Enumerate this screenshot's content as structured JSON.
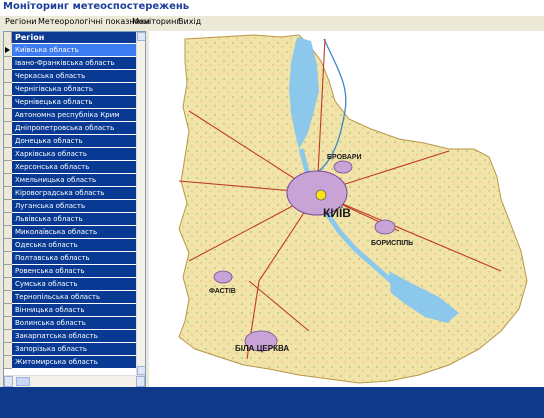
{
  "window": {
    "title": "Моніторинг метеоспостережень"
  },
  "menu": [
    "Регіони",
    "Метеорологічні показники",
    "Моніторинг",
    "Вихід"
  ],
  "regions": {
    "header": "Регіон",
    "items": [
      "Київська область",
      "Івано-Франківська область",
      "Черкаська область",
      "Чернігівська область",
      "Чернівецька область",
      "Автономна республіка Крим",
      "Дніпропетровська область",
      "Донецька область",
      "Харківська область",
      "Херсонська область",
      "Хмельницька область",
      "Кіровоградська область",
      "Луганська область",
      "Львівська область",
      "Миколаївська область",
      "Одеська область",
      "Полтавська область",
      "Ровенська область",
      "Сумська область",
      "Тернопільська область",
      "Вінницька область",
      "Волинська область",
      "Закарпатська область",
      "Запорізька область",
      "Житомирська область"
    ],
    "selected_index": 0
  },
  "map": {
    "cities": {
      "kyiv": "КИЇВ",
      "bila_tserkva": "БІЛА ЦЕРКВА",
      "boryspil": "БОРИСПІЛЬ",
      "brovary": "БРОВАРИ",
      "fastiv": "ФАСТІВ"
    },
    "colors": {
      "land": "#f2e3a8",
      "water": "#8cc8ec",
      "road": "#c0392b",
      "city": "#c7a3d6"
    }
  },
  "colors": {
    "accent": "#0f3a94",
    "selected_row": "#3c7cf0"
  }
}
